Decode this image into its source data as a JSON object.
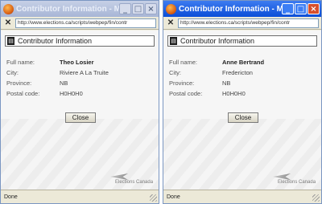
{
  "windows": [
    {
      "title": "Contributor Information - Mozilla ...",
      "url": "http://www.elections.ca/scripts/webpep/fin/contr",
      "panel_title": "Contributor Information",
      "fields": [
        {
          "label": "Full name:",
          "value": "Theo Losier"
        },
        {
          "label": "City:",
          "value": "Riviere A La Truite"
        },
        {
          "label": "Province:",
          "value": "NB"
        },
        {
          "label": "Postal code:",
          "value": "H0H0H0"
        }
      ],
      "close_label": "Close",
      "logo_text": "Elections Canada",
      "status": "Done",
      "active": false
    },
    {
      "title": "Contributor Information - Mozilla ...",
      "url": "http://www.elections.ca/scripts/webpep/fin/contr",
      "panel_title": "Contributor Information",
      "fields": [
        {
          "label": "Full name:",
          "value": "Anne Bertrand"
        },
        {
          "label": "City:",
          "value": "Fredericton"
        },
        {
          "label": "Province:",
          "value": "NB"
        },
        {
          "label": "Postal code:",
          "value": "H0H0H0"
        }
      ],
      "close_label": "Close",
      "logo_text": "Elections Canada",
      "status": "Done",
      "active": true
    }
  ],
  "window_buttons": {
    "minimize": "_",
    "maximize": "□",
    "close": "×"
  },
  "colors": {
    "active_title": "#0a4ed8",
    "inactive_title": "#a8b6d6"
  }
}
